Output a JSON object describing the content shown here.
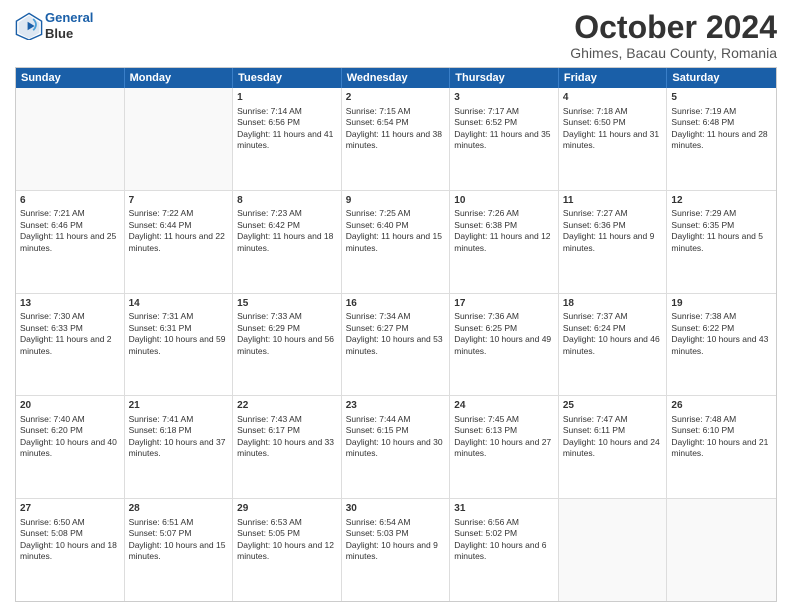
{
  "header": {
    "logo_line1": "General",
    "logo_line2": "Blue",
    "month": "October 2024",
    "location": "Ghimes, Bacau County, Romania"
  },
  "days": [
    "Sunday",
    "Monday",
    "Tuesday",
    "Wednesday",
    "Thursday",
    "Friday",
    "Saturday"
  ],
  "rows": [
    [
      {
        "day": "",
        "content": ""
      },
      {
        "day": "",
        "content": ""
      },
      {
        "day": "1",
        "content": "Sunrise: 7:14 AM\nSunset: 6:56 PM\nDaylight: 11 hours and 41 minutes."
      },
      {
        "day": "2",
        "content": "Sunrise: 7:15 AM\nSunset: 6:54 PM\nDaylight: 11 hours and 38 minutes."
      },
      {
        "day": "3",
        "content": "Sunrise: 7:17 AM\nSunset: 6:52 PM\nDaylight: 11 hours and 35 minutes."
      },
      {
        "day": "4",
        "content": "Sunrise: 7:18 AM\nSunset: 6:50 PM\nDaylight: 11 hours and 31 minutes."
      },
      {
        "day": "5",
        "content": "Sunrise: 7:19 AM\nSunset: 6:48 PM\nDaylight: 11 hours and 28 minutes."
      }
    ],
    [
      {
        "day": "6",
        "content": "Sunrise: 7:21 AM\nSunset: 6:46 PM\nDaylight: 11 hours and 25 minutes."
      },
      {
        "day": "7",
        "content": "Sunrise: 7:22 AM\nSunset: 6:44 PM\nDaylight: 11 hours and 22 minutes."
      },
      {
        "day": "8",
        "content": "Sunrise: 7:23 AM\nSunset: 6:42 PM\nDaylight: 11 hours and 18 minutes."
      },
      {
        "day": "9",
        "content": "Sunrise: 7:25 AM\nSunset: 6:40 PM\nDaylight: 11 hours and 15 minutes."
      },
      {
        "day": "10",
        "content": "Sunrise: 7:26 AM\nSunset: 6:38 PM\nDaylight: 11 hours and 12 minutes."
      },
      {
        "day": "11",
        "content": "Sunrise: 7:27 AM\nSunset: 6:36 PM\nDaylight: 11 hours and 9 minutes."
      },
      {
        "day": "12",
        "content": "Sunrise: 7:29 AM\nSunset: 6:35 PM\nDaylight: 11 hours and 5 minutes."
      }
    ],
    [
      {
        "day": "13",
        "content": "Sunrise: 7:30 AM\nSunset: 6:33 PM\nDaylight: 11 hours and 2 minutes."
      },
      {
        "day": "14",
        "content": "Sunrise: 7:31 AM\nSunset: 6:31 PM\nDaylight: 10 hours and 59 minutes."
      },
      {
        "day": "15",
        "content": "Sunrise: 7:33 AM\nSunset: 6:29 PM\nDaylight: 10 hours and 56 minutes."
      },
      {
        "day": "16",
        "content": "Sunrise: 7:34 AM\nSunset: 6:27 PM\nDaylight: 10 hours and 53 minutes."
      },
      {
        "day": "17",
        "content": "Sunrise: 7:36 AM\nSunset: 6:25 PM\nDaylight: 10 hours and 49 minutes."
      },
      {
        "day": "18",
        "content": "Sunrise: 7:37 AM\nSunset: 6:24 PM\nDaylight: 10 hours and 46 minutes."
      },
      {
        "day": "19",
        "content": "Sunrise: 7:38 AM\nSunset: 6:22 PM\nDaylight: 10 hours and 43 minutes."
      }
    ],
    [
      {
        "day": "20",
        "content": "Sunrise: 7:40 AM\nSunset: 6:20 PM\nDaylight: 10 hours and 40 minutes."
      },
      {
        "day": "21",
        "content": "Sunrise: 7:41 AM\nSunset: 6:18 PM\nDaylight: 10 hours and 37 minutes."
      },
      {
        "day": "22",
        "content": "Sunrise: 7:43 AM\nSunset: 6:17 PM\nDaylight: 10 hours and 33 minutes."
      },
      {
        "day": "23",
        "content": "Sunrise: 7:44 AM\nSunset: 6:15 PM\nDaylight: 10 hours and 30 minutes."
      },
      {
        "day": "24",
        "content": "Sunrise: 7:45 AM\nSunset: 6:13 PM\nDaylight: 10 hours and 27 minutes."
      },
      {
        "day": "25",
        "content": "Sunrise: 7:47 AM\nSunset: 6:11 PM\nDaylight: 10 hours and 24 minutes."
      },
      {
        "day": "26",
        "content": "Sunrise: 7:48 AM\nSunset: 6:10 PM\nDaylight: 10 hours and 21 minutes."
      }
    ],
    [
      {
        "day": "27",
        "content": "Sunrise: 6:50 AM\nSunset: 5:08 PM\nDaylight: 10 hours and 18 minutes."
      },
      {
        "day": "28",
        "content": "Sunrise: 6:51 AM\nSunset: 5:07 PM\nDaylight: 10 hours and 15 minutes."
      },
      {
        "day": "29",
        "content": "Sunrise: 6:53 AM\nSunset: 5:05 PM\nDaylight: 10 hours and 12 minutes."
      },
      {
        "day": "30",
        "content": "Sunrise: 6:54 AM\nSunset: 5:03 PM\nDaylight: 10 hours and 9 minutes."
      },
      {
        "day": "31",
        "content": "Sunrise: 6:56 AM\nSunset: 5:02 PM\nDaylight: 10 hours and 6 minutes."
      },
      {
        "day": "",
        "content": ""
      },
      {
        "day": "",
        "content": ""
      }
    ]
  ]
}
